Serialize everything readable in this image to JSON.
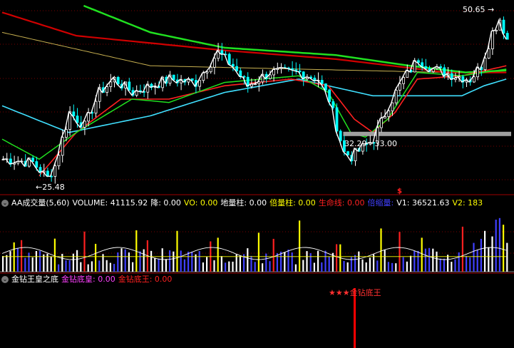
{
  "colors": {
    "bg": "#000000",
    "grid": "#7a0000",
    "separator": "#a00000",
    "up_candle": "#ffffff",
    "down_candle": "#00ffff",
    "ma_white": "#ffffff",
    "ma_red": "#ff2020",
    "ma_cyan": "#40e0ff",
    "ma_green": "#20e020",
    "ma_darkred": "#d00000",
    "ma_gold": "#c8b050",
    "support_bar": "#a0a0a0",
    "vol_yellow": "#ffff00",
    "vol_red": "#ff2020",
    "vol_blue": "#4040ff",
    "signal_red": "#ff0000"
  },
  "price_panel": {
    "high_label": "50.65",
    "low_label": "25.48",
    "range_label": "32.29 - 33.00",
    "signal_marker": "$"
  },
  "volume_header": {
    "title": "AA成交量(5,60)",
    "items": [
      {
        "label": "VOLUME:",
        "value": "41115.92",
        "color": "#ffffff"
      },
      {
        "label": "降:",
        "value": "0.00",
        "color": "#ffffff"
      },
      {
        "label": "VO:",
        "value": "0.00",
        "color": "#ffff00"
      },
      {
        "label": "地量柱:",
        "value": "0.00",
        "color": "#ffffff"
      },
      {
        "label": "倍量柱:",
        "value": "0.00",
        "color": "#ffff00"
      },
      {
        "label": "生命线:",
        "value": "0.00",
        "color": "#ff2020"
      },
      {
        "label": "倍缩量:",
        "value": "",
        "color": "#4040ff"
      },
      {
        "label": "V1:",
        "value": "36521.63",
        "color": "#ffffff"
      },
      {
        "label": "V2:",
        "value": "183",
        "color": "#ffff00"
      }
    ]
  },
  "indicator_header": {
    "title": "金钻王皇之底",
    "items": [
      {
        "label": "金钻底皇:",
        "value": "0.00",
        "color": "#ff40ff"
      },
      {
        "label": "金钻底王:",
        "value": "0.00",
        "color": "#ff2020"
      }
    ]
  },
  "indicator_signal_label": "★★★金钻底王",
  "chart_data": {
    "type": "candlestick",
    "title": "",
    "price_range": [
      24,
      52
    ],
    "annotations": {
      "max": 50.65,
      "min": 25.48,
      "support_low": 32.29,
      "support_high": 33.0
    },
    "signal_bar_index": 95
  }
}
